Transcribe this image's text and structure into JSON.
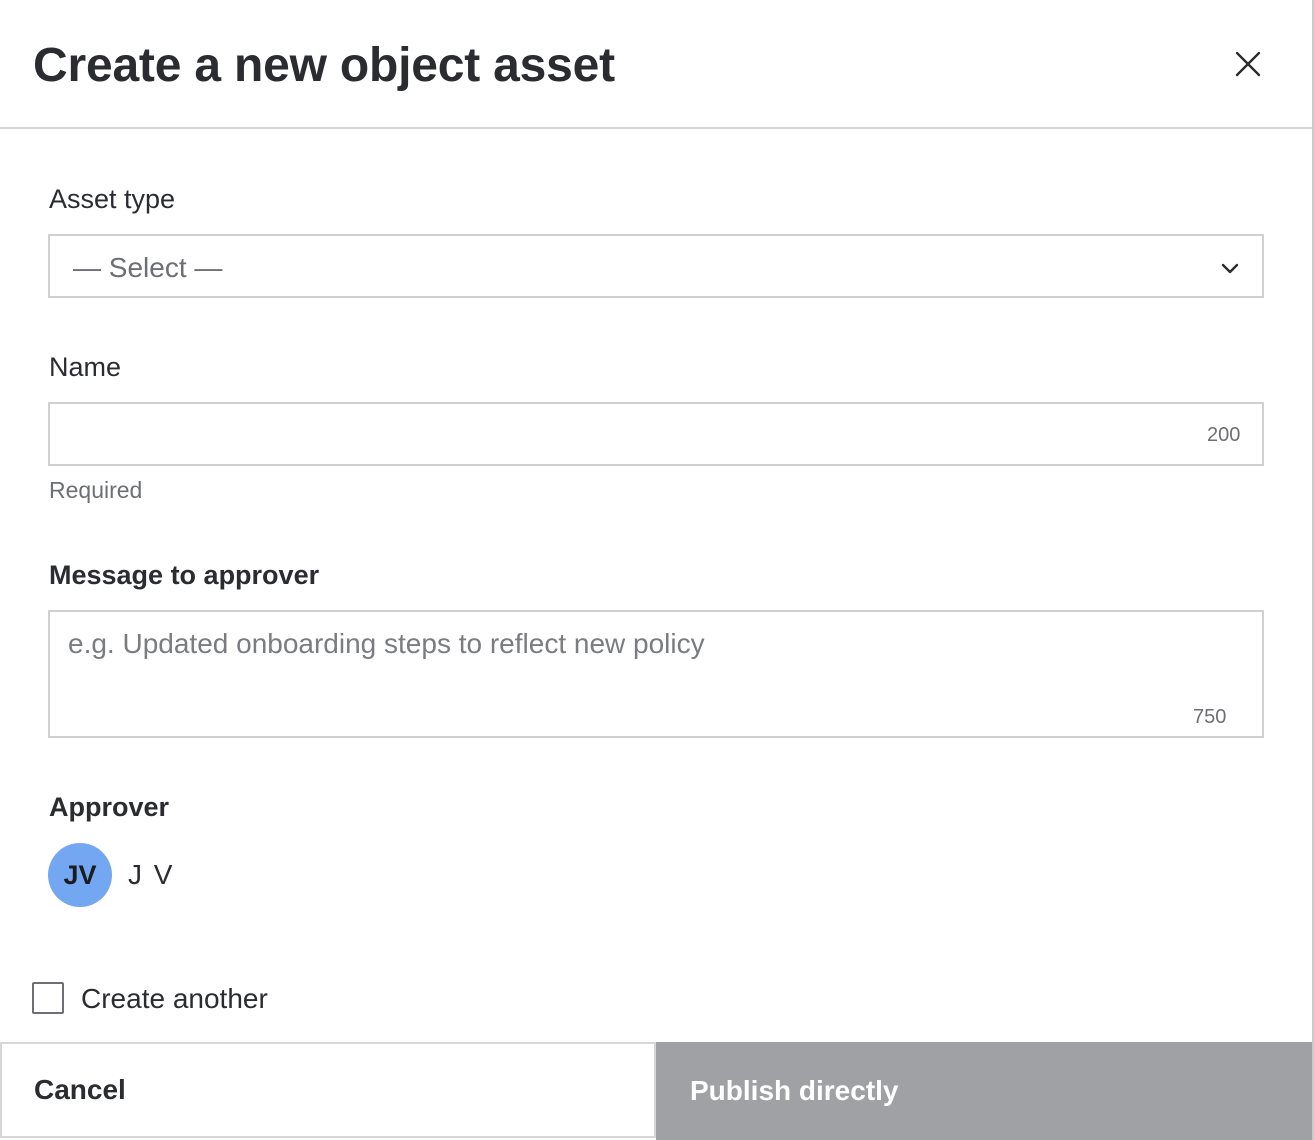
{
  "dialog": {
    "title": "Create a new object asset"
  },
  "asset_type": {
    "label": "Asset type",
    "selected": "— Select —"
  },
  "name_field": {
    "label": "Name",
    "value": "",
    "counter": "200",
    "hint": "Required"
  },
  "message_field": {
    "label": "Message to approver",
    "placeholder": "e.g. Updated onboarding steps to reflect new policy",
    "counter": "750"
  },
  "approver": {
    "label": "Approver",
    "initials": "JV",
    "name": "J V"
  },
  "create_another": {
    "label": "Create another",
    "checked": false
  },
  "footer": {
    "cancel_label": "Cancel",
    "publish_label": "Publish directly"
  },
  "colors": {
    "avatar": "#74a7f2",
    "publish_disabled": "#a0a1a4"
  }
}
